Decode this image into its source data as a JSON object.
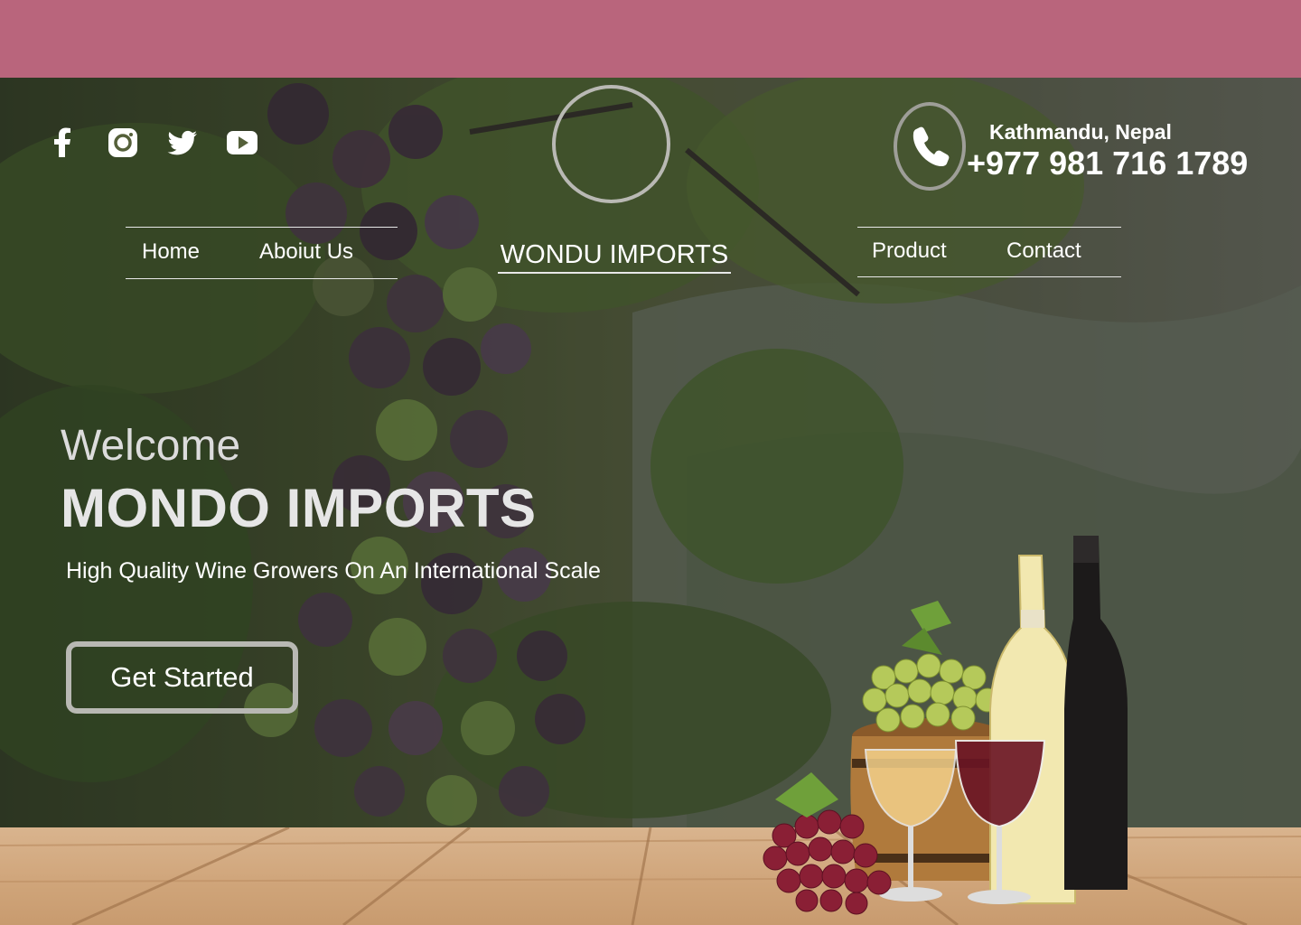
{
  "header": {
    "location": "Kathmandu, Nepal",
    "phone": "+977 981 716 1789",
    "brand": "WONDU IMPORTS"
  },
  "social": [
    "facebook-icon",
    "instagram-icon",
    "twitter-icon",
    "youtube-icon"
  ],
  "nav": {
    "left": [
      {
        "label": "Home"
      },
      {
        "label": "Aboiut Us"
      }
    ],
    "right": [
      {
        "label": "Product"
      },
      {
        "label": "Contact"
      }
    ]
  },
  "hero": {
    "welcome": "Welcome",
    "headline": "MONDO IMPORTS",
    "tagline": "High Quality Wine Growers On An International Scale",
    "cta": "Get Started"
  },
  "colors": {
    "top_band": "#b9657c",
    "text": "#ffffff",
    "ring": "#b9b9b4"
  }
}
